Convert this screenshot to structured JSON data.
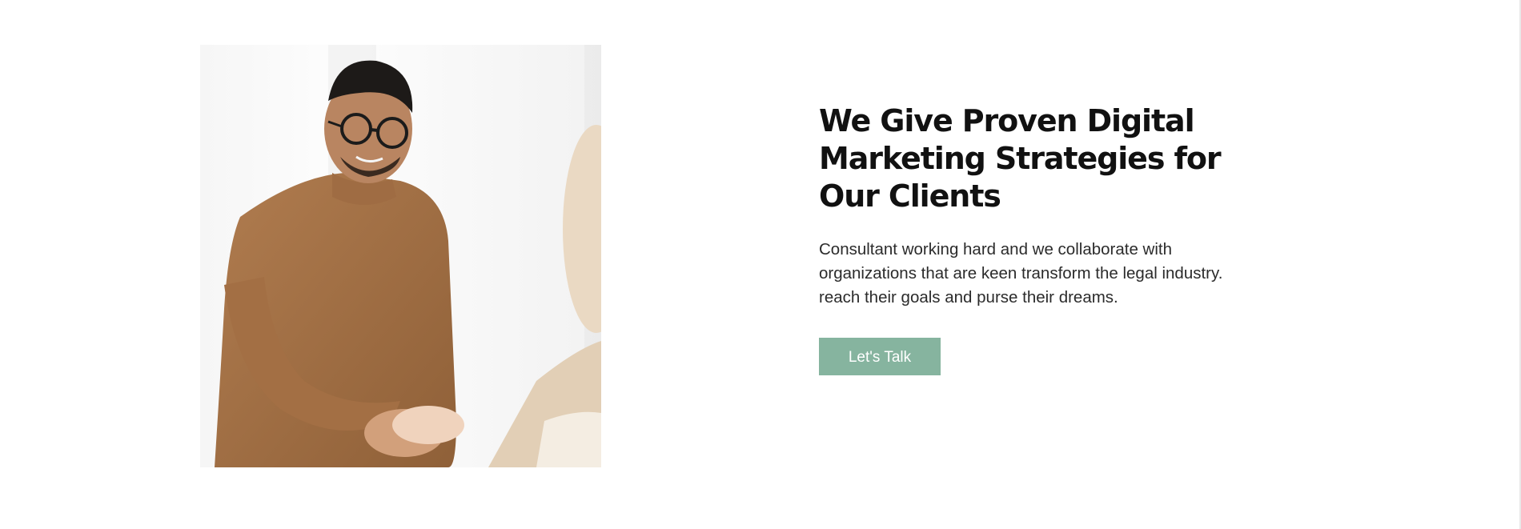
{
  "hero": {
    "image_alt": "Man in brown sweater with glasses shaking hands",
    "headline": "We Give Proven Digital Marketing Strategies for Our Clients",
    "description": "Consultant working hard and we collaborate with organizations that are keen transform the legal industry. reach their goals and purse their dreams.",
    "cta_label": "Let's Talk"
  },
  "colors": {
    "accent": "#86b49f",
    "heading": "#111111",
    "body": "#2b2b2b",
    "background": "#ffffff"
  }
}
